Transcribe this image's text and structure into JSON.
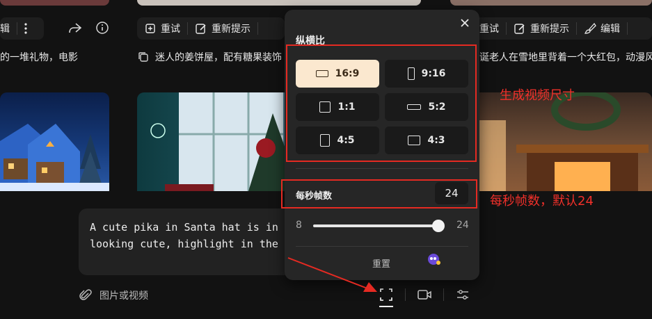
{
  "colors": {
    "accent_selected": "#fbe8cf",
    "annotation_red": "#e52a22"
  },
  "left_card": {
    "action_label": "辑",
    "caption": "的一堆礼物，电影",
    "icons": [
      "more-vertical-icon",
      "share-icon",
      "info-icon"
    ]
  },
  "mid_card": {
    "retry_label": "重试",
    "reprompt_label": "重新提示",
    "caption": "迷人的姜饼屋，配有糖果装饰"
  },
  "right_card": {
    "retry_label": "重试",
    "reprompt_label": "重新提示",
    "edit_label": "编辑",
    "caption": "诞老人在雪地里背着一个大红包，动漫风"
  },
  "prompt": {
    "line1": "A cute pika in Santa hat is in",
    "line2": "looking cute, highlight in the"
  },
  "attach_label": "图片或视频",
  "popup": {
    "title": "纵横比",
    "ratios": [
      {
        "label": "16:9",
        "selected": true
      },
      {
        "label": "9:16",
        "selected": false
      },
      {
        "label": "1:1",
        "selected": false
      },
      {
        "label": "5:2",
        "selected": false
      },
      {
        "label": "4:5",
        "selected": false
      },
      {
        "label": "4:3",
        "selected": false
      }
    ],
    "fps_label": "每秒帧数",
    "fps_value": "24",
    "slider_min": "8",
    "slider_max": "24",
    "slider_fraction": 1.0,
    "reset_label": "重置"
  },
  "annotations": {
    "ratio_note": "生成视频尺寸",
    "fps_note": "每秒帧数，默认24"
  }
}
